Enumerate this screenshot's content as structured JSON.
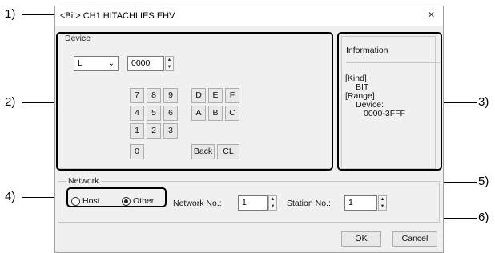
{
  "dialog": {
    "title": "<Bit> CH1 HITACHI IES EHV",
    "close": "×"
  },
  "device": {
    "group_label": "Device",
    "type_value": "L",
    "address_value": "0000",
    "keypad": [
      "7",
      "8",
      "9",
      "D",
      "E",
      "F",
      "4",
      "5",
      "6",
      "A",
      "B",
      "C",
      "1",
      "2",
      "3",
      "0"
    ],
    "back_label": "Back",
    "clear_label": "CL"
  },
  "information": {
    "header": "Information",
    "kind_label": "[Kind]",
    "kind_value": "BIT",
    "range_label": "[Range]",
    "range_device_label": "Device:",
    "range_value": "0000-3FFF"
  },
  "network": {
    "group_label": "Network",
    "host_label": "Host",
    "other_label": "Other",
    "selected": "Other",
    "network_no_label": "Network No.:",
    "network_no_value": "1",
    "station_no_label": "Station No.:",
    "station_no_value": "1"
  },
  "footer": {
    "ok_label": "OK",
    "cancel_label": "Cancel"
  },
  "callouts": [
    "1)",
    "2)",
    "3)",
    "4)",
    "5)",
    "6)"
  ]
}
